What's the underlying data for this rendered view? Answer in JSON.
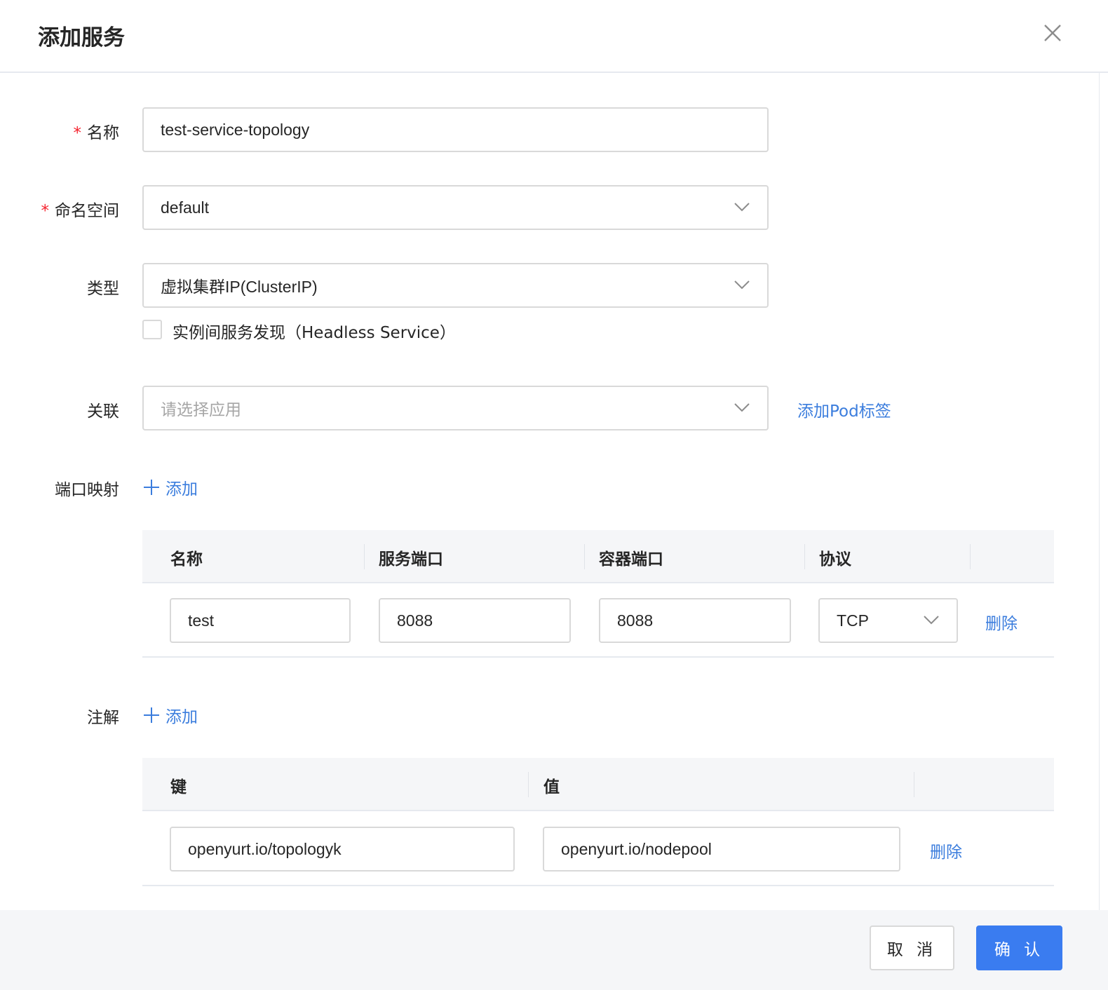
{
  "dialog": {
    "title": "添加服务"
  },
  "form": {
    "name": {
      "label": "名称",
      "required_mark": "*",
      "value": "test-service-topology"
    },
    "namespace": {
      "label": "命名空间",
      "required_mark": "*",
      "value": "default"
    },
    "type": {
      "label": "类型",
      "value": "虚拟集群IP(ClusterIP)"
    },
    "headless": {
      "label": "实例间服务发现（Headless Service）",
      "checked": false
    },
    "association": {
      "label": "关联",
      "placeholder": "请选择应用",
      "add_pod_label": "添加Pod标签"
    },
    "port_mapping": {
      "label": "端口映射",
      "add_label": "添加",
      "columns": [
        "名称",
        "服务端口",
        "容器端口",
        "协议"
      ],
      "rows": [
        {
          "name": "test",
          "service_port": "8088",
          "container_port": "8088",
          "protocol": "TCP",
          "delete_label": "删除"
        }
      ]
    },
    "annotations": {
      "label": "注解",
      "add_label": "添加",
      "columns": [
        "键",
        "值"
      ],
      "rows": [
        {
          "key": "openyurt.io/topologyk",
          "value": "openyurt.io/nodepool",
          "delete_label": "删除"
        }
      ]
    }
  },
  "footer": {
    "cancel_label": "取 消",
    "ok_label": "确 认"
  },
  "colors": {
    "accent": "#3a7cf0",
    "link": "#3b7ddd",
    "required": "#f5222d",
    "table_header_bg": "#f5f6f8"
  }
}
